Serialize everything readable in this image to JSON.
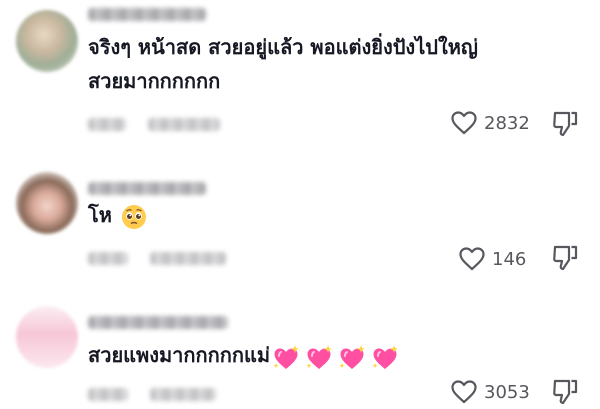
{
  "comments": [
    {
      "text": "จริงๆ หน้าสด สวยอยู่แล้ว พอแต่งยิ่งปังไปใหญ่ สวยมากกกกกก",
      "likes": "2832",
      "emojis": []
    },
    {
      "text": "โห",
      "likes": "146",
      "emojis": [
        "pleading-face-emoji"
      ]
    },
    {
      "text": "สวยแพงมากกกกกแม่",
      "likes": "3053",
      "emojis": [
        "sparkling-heart-emoji",
        "sparkling-heart-emoji",
        "sparkling-heart-emoji",
        "sparkling-heart-emoji"
      ]
    }
  ],
  "icons": {
    "like": "heart-outline-icon",
    "dislike": "thumbs-down-icon"
  },
  "colors": {
    "text": "#161823",
    "count": "#57575e",
    "icon": "#57575e",
    "heart_emoji": "#ff4fa3"
  }
}
